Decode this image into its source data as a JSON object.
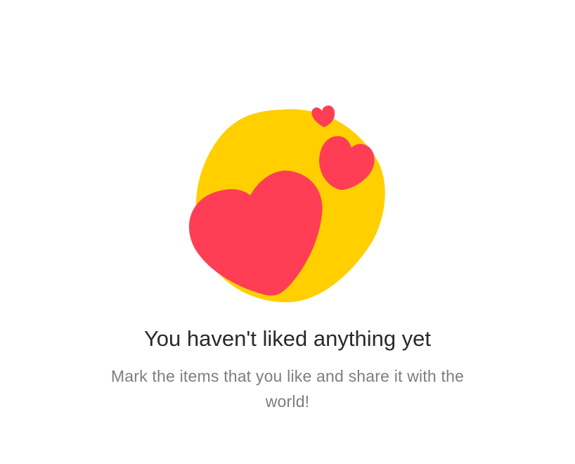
{
  "empty_state": {
    "title": "You haven't liked anything yet",
    "subtitle": "Mark the items that you like and share it with the world!"
  },
  "illustration": {
    "blob_color": "#FFCF00",
    "heart_color": "#FF3E55"
  }
}
